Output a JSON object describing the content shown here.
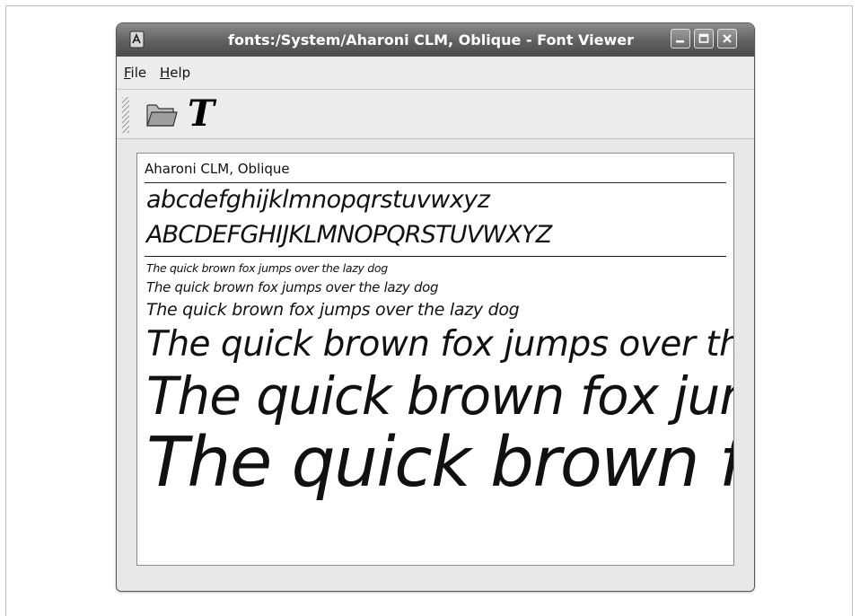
{
  "window": {
    "title": "fonts:/System/Aharoni CLM, Oblique - Font Viewer"
  },
  "menubar": {
    "file_rest": "ile",
    "file_mnemonic": "F",
    "help_rest": "elp",
    "help_mnemonic": "H"
  },
  "toolbar": {
    "open_icon": "folder-open-icon",
    "font_icon": "font-icon",
    "font_glyph": "T"
  },
  "preview": {
    "font_name": "Aharoni CLM, Oblique",
    "lowercase": "abcdefghijklmnopqrstuvwxyz",
    "uppercase": "ABCDEFGHIJKLMNOPQRSTUVWXYZ",
    "samples": [
      "The quick brown fox jumps over the lazy dog",
      "The quick brown fox jumps over the lazy dog",
      "The quick brown fox jumps over the lazy dog",
      "The quick brown fox jumps over the lazy dog",
      "The quick brown fox jumps over the lazy dog",
      "The quick brown fox jumps over the lazy dog"
    ]
  }
}
